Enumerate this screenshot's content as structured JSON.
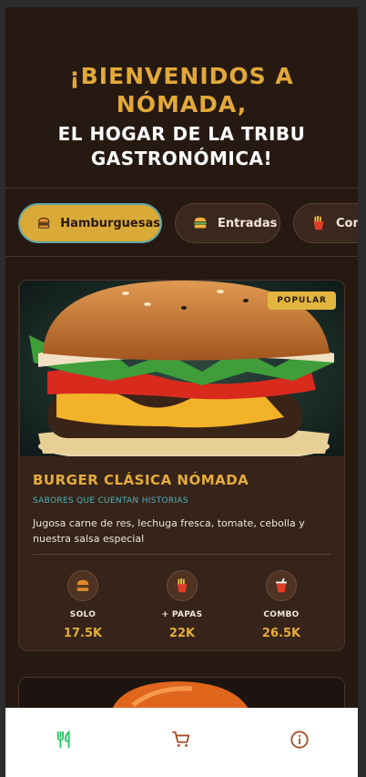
{
  "header": {
    "line1": "¡BIENVENIDOS A NÓMADA,",
    "line2": "EL HOGAR DE LA TRIBU GASTRONÓMICA!"
  },
  "tabs": [
    {
      "label": "Hamburguesas",
      "icon": "burger-icon",
      "active": true
    },
    {
      "label": "Entradas",
      "icon": "sandwich-icon",
      "active": false
    },
    {
      "label": "Com",
      "icon": "fries-icon",
      "active": false
    }
  ],
  "card": {
    "badge": "POPULAR",
    "name": "BURGER CLÁSICA NÓMADA",
    "tagline": "SABORES QUE CUENTAN HISTORIAS",
    "description": "Jugosa carne de res, lechuga fresca, tomate, cebolla y nuestra salsa especial",
    "options": [
      {
        "label": "SOLO",
        "price": "17.5K",
        "icon": "burger-icon"
      },
      {
        "label": "+ PAPAS",
        "price": "22K",
        "icon": "fries-icon"
      },
      {
        "label": "COMBO",
        "price": "26.5K",
        "icon": "drink-icon"
      }
    ]
  },
  "bottom_nav": [
    {
      "name": "menu",
      "icon": "utensils-icon",
      "color": "#22c55e"
    },
    {
      "name": "cart",
      "icon": "cart-icon",
      "color": "#a5502a"
    },
    {
      "name": "info",
      "icon": "info-icon",
      "color": "#a5502a"
    }
  ],
  "colors": {
    "accent": "#e2a83a",
    "background": "#251912",
    "teal": "#4fb3b7"
  }
}
